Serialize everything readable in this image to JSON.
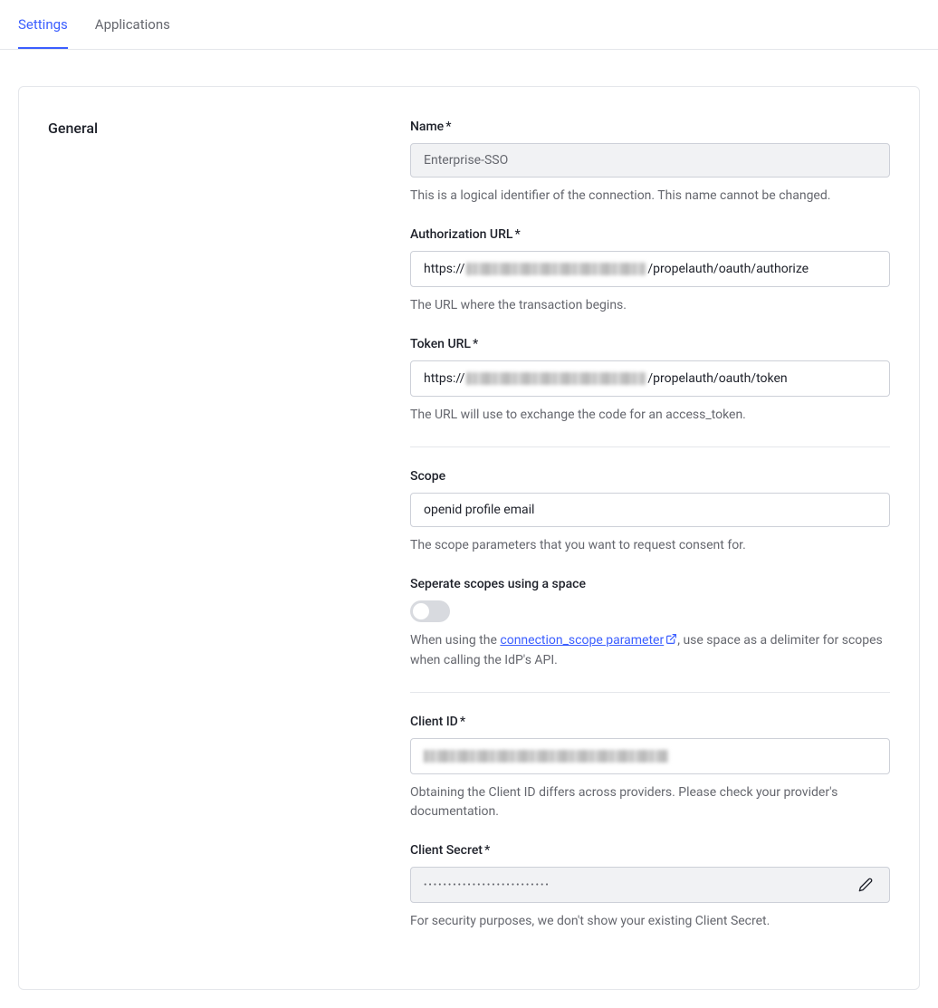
{
  "tabs": {
    "settings": "Settings",
    "applications": "Applications"
  },
  "section": {
    "title": "General"
  },
  "fields": {
    "name": {
      "label": "Name",
      "value": "Enterprise-SSO",
      "help": "This is a logical identifier of the connection. This name cannot be changed."
    },
    "auth_url": {
      "label": "Authorization URL",
      "prefix": "https://",
      "suffix": "/propelauth/oauth/authorize",
      "help": "The URL where the transaction begins."
    },
    "token_url": {
      "label": "Token URL",
      "prefix": "https://",
      "suffix": "/propelauth/oauth/token",
      "help": "The URL will use to exchange the code for an access_token."
    },
    "scope": {
      "label": "Scope",
      "value": "openid profile email",
      "help": "The scope parameters that you want to request consent for."
    },
    "separate_scopes": {
      "label": "Seperate scopes using a space",
      "help_before": "When using the ",
      "link_text": "connection_scope parameter",
      "help_after": ", use space as a delimiter for scopes when calling the IdP's API."
    },
    "client_id": {
      "label": "Client ID",
      "help": "Obtaining the Client ID differs across providers. Please check your provider's documentation."
    },
    "client_secret": {
      "label": "Client Secret",
      "dots": "••••••••••••••••••••••••••",
      "help": "For security purposes, we don't show your existing Client Secret."
    }
  }
}
